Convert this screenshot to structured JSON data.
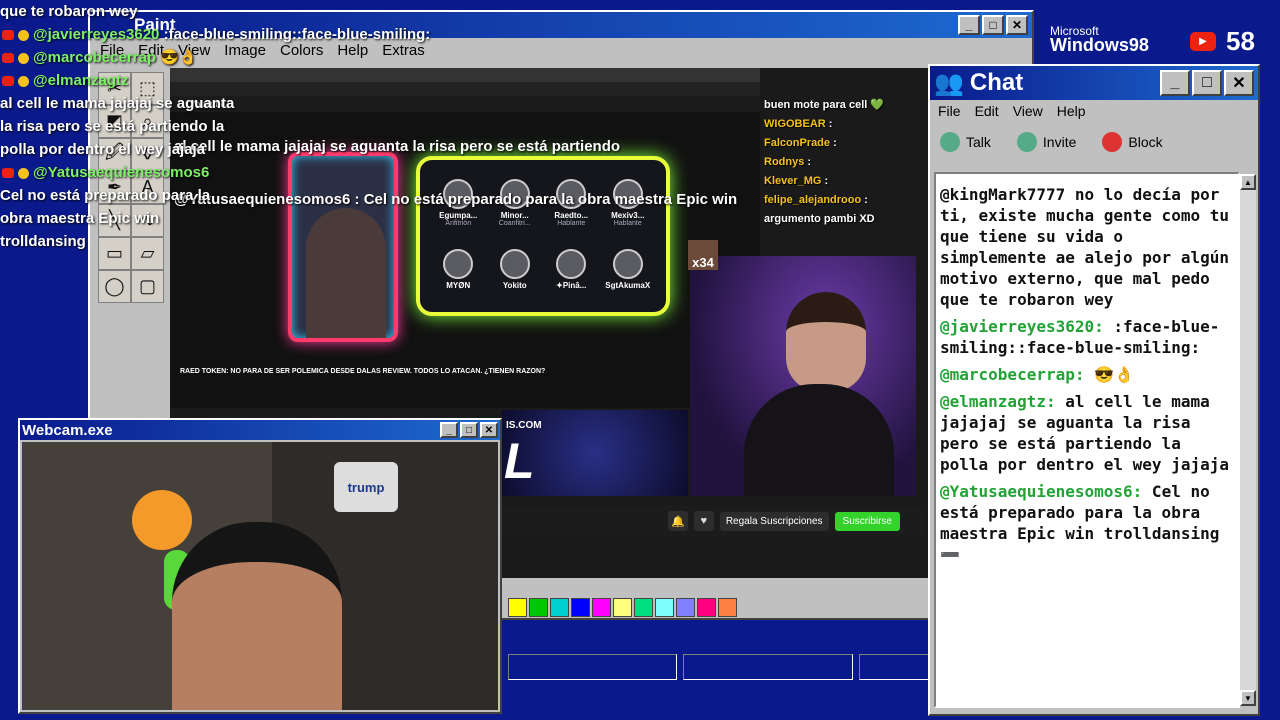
{
  "overlay_chat": {
    "top_fragment": "que te robaron wey",
    "lines": [
      {
        "user": "@javierreyes3620",
        "text": ":face-blue-smiling::face-blue-smiling:"
      },
      {
        "user": "@marcobecerrap",
        "text": "😎👌"
      },
      {
        "user": "@elmanzagtz",
        "text": "al cell le mama jajajaj se aguanta la risa pero se está partiendo la polla por dentro el wey jajaja"
      },
      {
        "user": "@Yatusaequienesomos6",
        "text": "Cel no está preparado para la obra maestra Epic win trolldansing"
      }
    ]
  },
  "paint": {
    "title": "Paint",
    "menu": [
      "File",
      "Edit",
      "View",
      "Image",
      "Colors",
      "Help",
      "Extras"
    ],
    "tools": [
      "✂",
      "⬚",
      "◩",
      "⌕",
      "🖉",
      "⚱",
      "✒",
      "A",
      "╲",
      "∿",
      "▭",
      "▱",
      "◯",
      "▢"
    ],
    "palette": [
      "#ffff00",
      "#00c800",
      "#00d0d0",
      "#0000ff",
      "#ff00ff",
      "#ffff80",
      "#00e080",
      "#80ffff",
      "#8080ff",
      "#ff0080",
      "#ff8040"
    ],
    "canvas_caption_1": "al cell le mama jajajaj se aguanta la risa pero se está partiendo",
    "canvas_caption_2": "@Yatusaequienesomos6 : Cel no está preparado para la obra maestra Epic win"
  },
  "stream": {
    "yt_label": "YouTube",
    "participants": [
      {
        "name": "Egumpa...",
        "role": "Anfitrión"
      },
      {
        "name": "Minor...",
        "role": "Coanfitri..."
      },
      {
        "name": "Raedto...",
        "role": "Hablante"
      },
      {
        "name": "Mexiv3...",
        "role": "Hablante"
      },
      {
        "name": "MYØN",
        "role": ""
      },
      {
        "name": "Yokito",
        "role": ""
      },
      {
        "name": "✦Pinā...",
        "role": ""
      },
      {
        "name": "SgtAkumaX",
        "role": ""
      }
    ],
    "video_title": "RAED TOKEN: NO PARA DE SER POLEMICA DESDE DALAS REVIEW. TODOS LO ATACAN. ¿TIENEN RAZON?",
    "x_count": "x34",
    "space_url": "IS.COM",
    "space_big": "L",
    "regala_label": "Regala Suscripciones",
    "subscribe_label": "Suscribirse",
    "mid_chat": [
      {
        "user": "",
        "text": "buen mote para cell 💚"
      },
      {
        "user": "WIGOBEAR",
        "text": ":"
      },
      {
        "user": "FalconPrade",
        "text": ":"
      },
      {
        "user": "Rodnys",
        "text": ":"
      },
      {
        "user": "Klever_MG",
        "text": ":"
      },
      {
        "user": "felipe_alejandrooo",
        "text": ":"
      },
      {
        "user": "",
        "text": "argumento pambi XD"
      }
    ]
  },
  "chat": {
    "title": "Chat",
    "menu": [
      "File",
      "Edit",
      "View",
      "Help"
    ],
    "tools": [
      {
        "label": "Talk",
        "icon": "talk-icon"
      },
      {
        "label": "Invite",
        "icon": "invite-icon"
      },
      {
        "label": "Block",
        "icon": "block-icon"
      }
    ],
    "messages": [
      {
        "user": "",
        "text": "@kingMark7777 no lo decía por ti, existe mucha gente como tu que tiene su vida o simplemente ae alejo por algún motivo externo, que mal pedo que te robaron wey"
      },
      {
        "user": "@javierreyes3620:",
        "text": " :face-blue-smiling::face-blue-smiling:"
      },
      {
        "user": "@marcobecerrap:",
        "text": " 😎👌"
      },
      {
        "user": "@elmanzagtz:",
        "text": " al cell le mama jajajaj se aguanta la risa pero se está partiendo la polla por dentro el wey jajaja"
      },
      {
        "user": "@Yatusaequienesomos6:",
        "text": " Cel no está preparado para la obra maestra Epic win trolldansing ➖"
      }
    ]
  },
  "webcam": {
    "title": "Webcam.exe",
    "roll_label": "trump"
  },
  "brand": {
    "line1": "Microsoft",
    "line2": "Windows98"
  },
  "viewers": {
    "count": "58"
  }
}
